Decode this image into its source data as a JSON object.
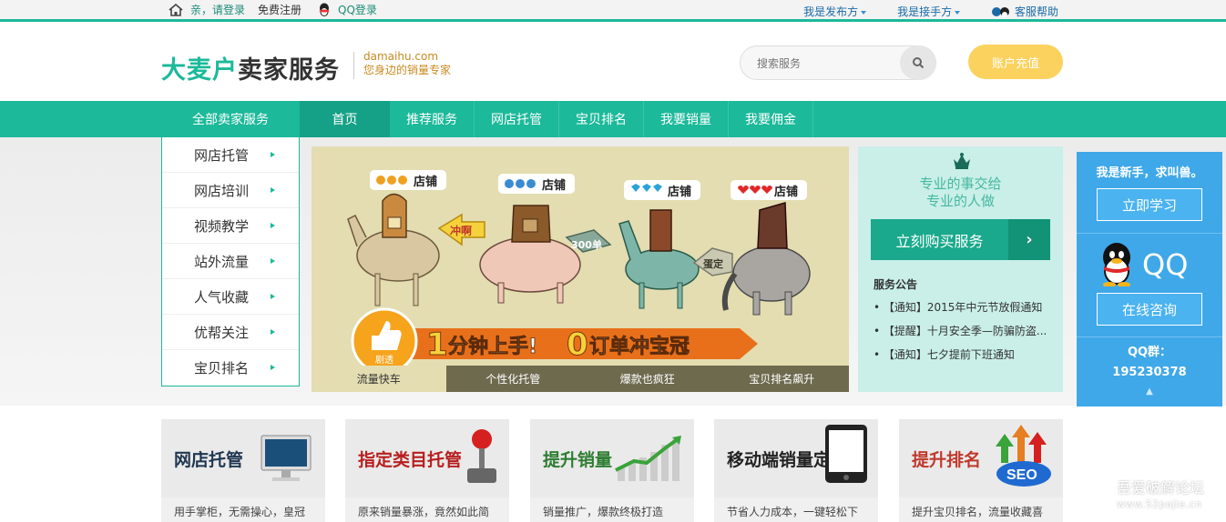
{
  "topbar": {
    "login": "亲，请登录",
    "register": "免费注册",
    "qq_login": "QQ登录",
    "publisher": "我是发布方",
    "receiver": "我是接手方",
    "help": "客服帮助"
  },
  "header": {
    "logo_part1": "大麦户",
    "logo_part2": "卖家服务",
    "domain": "damaihu.com",
    "slogan": "您身边的销量专家",
    "search_placeholder": "搜索服务",
    "recharge": "账户充值"
  },
  "nav": {
    "all": "全部卖家服务",
    "items": [
      "首页",
      "推荐服务",
      "网店托管",
      "宝贝排名",
      "我要销量",
      "我要佣金"
    ]
  },
  "side_menu": [
    "网店托管",
    "网店培训",
    "视频教学",
    "站外流量",
    "人气收藏",
    "优帮关注",
    "宝贝排名"
  ],
  "banner": {
    "shop_labels": [
      "店铺",
      "店铺",
      "店铺",
      "店铺"
    ],
    "arrow1": "冲啊",
    "arrow2": "300单",
    "arrow3": "蛋定",
    "headline_num1": "1",
    "headline_part1": "分钟上手!",
    "headline_num2": "0",
    "headline_part2": "订单冲宝冠",
    "badge": "剧透",
    "tabs": [
      "流量快车",
      "个性化托管",
      "爆款也疯狂",
      "宝贝排名飙升"
    ]
  },
  "service": {
    "slogan1": "专业的事交给",
    "slogan2": "专业的人做",
    "buy": "立刻购买服务",
    "buy_arrow": "›",
    "notice_title": "服务公告",
    "notices": [
      "• 【通知】2015年中元节放假通知",
      "• 【提醒】十月安全季—防骗防盗...",
      "• 【通知】七夕提前下班通知"
    ]
  },
  "float": {
    "title": "我是新手，求叫兽。",
    "learn": "立即学习",
    "qq": "QQ",
    "consult": "在线咨询",
    "group_label": "QQ群：",
    "group_no": "195230378",
    "up": "▲"
  },
  "cards": [
    {
      "title": "网店托管",
      "desc": "用手掌柜，无需操心，皇冠",
      "color": "#1f3650"
    },
    {
      "title": "指定类目托管",
      "desc": "原来销量暴涨，竟然如此简",
      "color": "#b81e1e"
    },
    {
      "title": "提升销量",
      "desc": "销量推广，爆款终极打造",
      "color": "#2e7d32"
    },
    {
      "title": "移动端销量定制",
      "desc": "节省人力成本，一键轻松下",
      "color": "#222222"
    },
    {
      "title": "提升排名",
      "desc": "提升宝贝排名，流量收藏喜",
      "color": "#c0392b"
    }
  ],
  "watermark": {
    "name": "吾爱破解论坛",
    "url": "www.52pojie.cn"
  }
}
